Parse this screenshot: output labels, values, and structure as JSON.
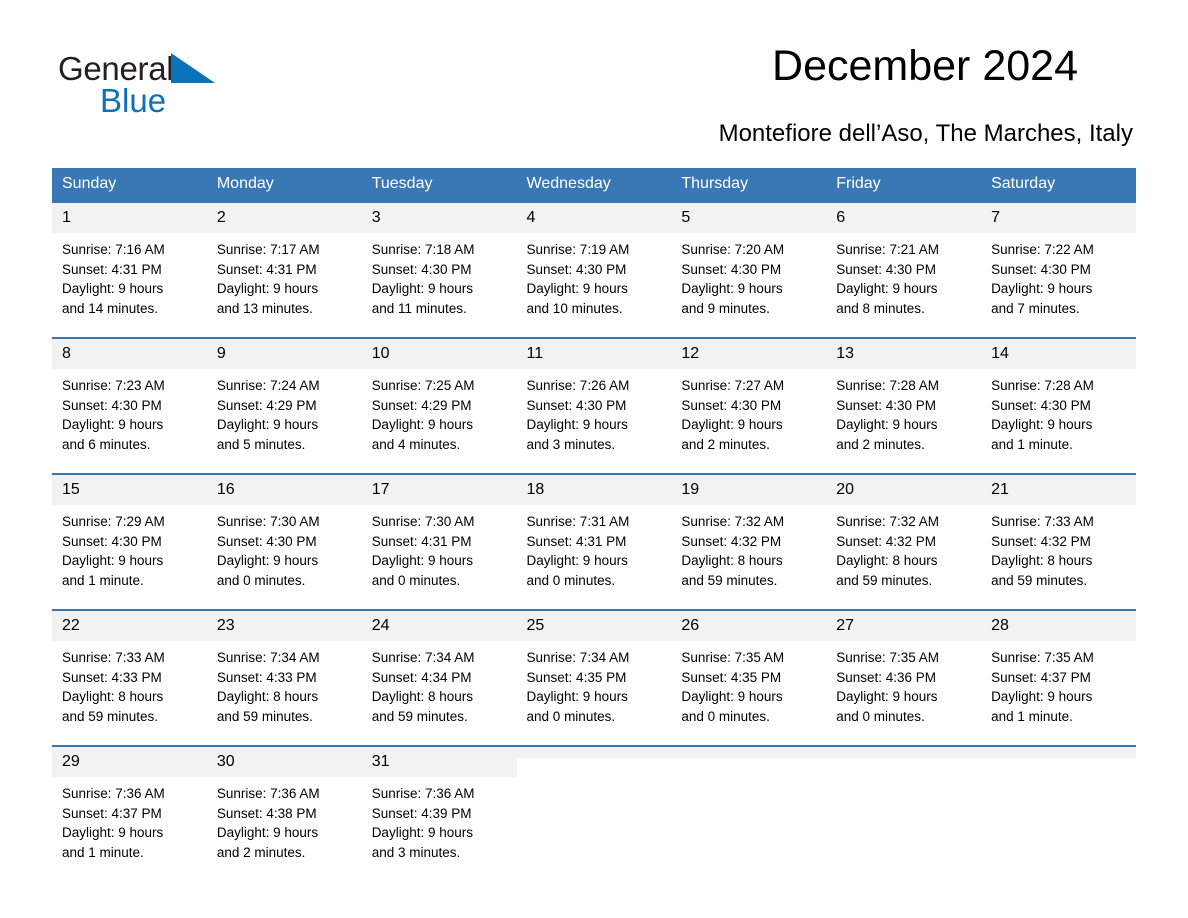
{
  "brand": {
    "name_part1": "General",
    "name_part2": "Blue",
    "accent_color": "#0b72b9",
    "triangle_icon": "triangle-icon"
  },
  "header": {
    "month_title": "December 2024",
    "location": "Montefiore dell’Aso, The Marches, Italy"
  },
  "calendar": {
    "header_bg": "#3a78b5",
    "daynum_bg": "#f2f2f2",
    "weekday_headers": [
      "Sunday",
      "Monday",
      "Tuesday",
      "Wednesday",
      "Thursday",
      "Friday",
      "Saturday"
    ],
    "weeks": [
      [
        {
          "day": "1",
          "sunrise": "Sunrise: 7:16 AM",
          "sunset": "Sunset: 4:31 PM",
          "daylight_line1": "Daylight: 9 hours",
          "daylight_line2": "and 14 minutes."
        },
        {
          "day": "2",
          "sunrise": "Sunrise: 7:17 AM",
          "sunset": "Sunset: 4:31 PM",
          "daylight_line1": "Daylight: 9 hours",
          "daylight_line2": "and 13 minutes."
        },
        {
          "day": "3",
          "sunrise": "Sunrise: 7:18 AM",
          "sunset": "Sunset: 4:30 PM",
          "daylight_line1": "Daylight: 9 hours",
          "daylight_line2": "and 11 minutes."
        },
        {
          "day": "4",
          "sunrise": "Sunrise: 7:19 AM",
          "sunset": "Sunset: 4:30 PM",
          "daylight_line1": "Daylight: 9 hours",
          "daylight_line2": "and 10 minutes."
        },
        {
          "day": "5",
          "sunrise": "Sunrise: 7:20 AM",
          "sunset": "Sunset: 4:30 PM",
          "daylight_line1": "Daylight: 9 hours",
          "daylight_line2": "and 9 minutes."
        },
        {
          "day": "6",
          "sunrise": "Sunrise: 7:21 AM",
          "sunset": "Sunset: 4:30 PM",
          "daylight_line1": "Daylight: 9 hours",
          "daylight_line2": "and 8 minutes."
        },
        {
          "day": "7",
          "sunrise": "Sunrise: 7:22 AM",
          "sunset": "Sunset: 4:30 PM",
          "daylight_line1": "Daylight: 9 hours",
          "daylight_line2": "and 7 minutes."
        }
      ],
      [
        {
          "day": "8",
          "sunrise": "Sunrise: 7:23 AM",
          "sunset": "Sunset: 4:30 PM",
          "daylight_line1": "Daylight: 9 hours",
          "daylight_line2": "and 6 minutes."
        },
        {
          "day": "9",
          "sunrise": "Sunrise: 7:24 AM",
          "sunset": "Sunset: 4:29 PM",
          "daylight_line1": "Daylight: 9 hours",
          "daylight_line2": "and 5 minutes."
        },
        {
          "day": "10",
          "sunrise": "Sunrise: 7:25 AM",
          "sunset": "Sunset: 4:29 PM",
          "daylight_line1": "Daylight: 9 hours",
          "daylight_line2": "and 4 minutes."
        },
        {
          "day": "11",
          "sunrise": "Sunrise: 7:26 AM",
          "sunset": "Sunset: 4:30 PM",
          "daylight_line1": "Daylight: 9 hours",
          "daylight_line2": "and 3 minutes."
        },
        {
          "day": "12",
          "sunrise": "Sunrise: 7:27 AM",
          "sunset": "Sunset: 4:30 PM",
          "daylight_line1": "Daylight: 9 hours",
          "daylight_line2": "and 2 minutes."
        },
        {
          "day": "13",
          "sunrise": "Sunrise: 7:28 AM",
          "sunset": "Sunset: 4:30 PM",
          "daylight_line1": "Daylight: 9 hours",
          "daylight_line2": "and 2 minutes."
        },
        {
          "day": "14",
          "sunrise": "Sunrise: 7:28 AM",
          "sunset": "Sunset: 4:30 PM",
          "daylight_line1": "Daylight: 9 hours",
          "daylight_line2": "and 1 minute."
        }
      ],
      [
        {
          "day": "15",
          "sunrise": "Sunrise: 7:29 AM",
          "sunset": "Sunset: 4:30 PM",
          "daylight_line1": "Daylight: 9 hours",
          "daylight_line2": "and 1 minute."
        },
        {
          "day": "16",
          "sunrise": "Sunrise: 7:30 AM",
          "sunset": "Sunset: 4:30 PM",
          "daylight_line1": "Daylight: 9 hours",
          "daylight_line2": "and 0 minutes."
        },
        {
          "day": "17",
          "sunrise": "Sunrise: 7:30 AM",
          "sunset": "Sunset: 4:31 PM",
          "daylight_line1": "Daylight: 9 hours",
          "daylight_line2": "and 0 minutes."
        },
        {
          "day": "18",
          "sunrise": "Sunrise: 7:31 AM",
          "sunset": "Sunset: 4:31 PM",
          "daylight_line1": "Daylight: 9 hours",
          "daylight_line2": "and 0 minutes."
        },
        {
          "day": "19",
          "sunrise": "Sunrise: 7:32 AM",
          "sunset": "Sunset: 4:32 PM",
          "daylight_line1": "Daylight: 8 hours",
          "daylight_line2": "and 59 minutes."
        },
        {
          "day": "20",
          "sunrise": "Sunrise: 7:32 AM",
          "sunset": "Sunset: 4:32 PM",
          "daylight_line1": "Daylight: 8 hours",
          "daylight_line2": "and 59 minutes."
        },
        {
          "day": "21",
          "sunrise": "Sunrise: 7:33 AM",
          "sunset": "Sunset: 4:32 PM",
          "daylight_line1": "Daylight: 8 hours",
          "daylight_line2": "and 59 minutes."
        }
      ],
      [
        {
          "day": "22",
          "sunrise": "Sunrise: 7:33 AM",
          "sunset": "Sunset: 4:33 PM",
          "daylight_line1": "Daylight: 8 hours",
          "daylight_line2": "and 59 minutes."
        },
        {
          "day": "23",
          "sunrise": "Sunrise: 7:34 AM",
          "sunset": "Sunset: 4:33 PM",
          "daylight_line1": "Daylight: 8 hours",
          "daylight_line2": "and 59 minutes."
        },
        {
          "day": "24",
          "sunrise": "Sunrise: 7:34 AM",
          "sunset": "Sunset: 4:34 PM",
          "daylight_line1": "Daylight: 8 hours",
          "daylight_line2": "and 59 minutes."
        },
        {
          "day": "25",
          "sunrise": "Sunrise: 7:34 AM",
          "sunset": "Sunset: 4:35 PM",
          "daylight_line1": "Daylight: 9 hours",
          "daylight_line2": "and 0 minutes."
        },
        {
          "day": "26",
          "sunrise": "Sunrise: 7:35 AM",
          "sunset": "Sunset: 4:35 PM",
          "daylight_line1": "Daylight: 9 hours",
          "daylight_line2": "and 0 minutes."
        },
        {
          "day": "27",
          "sunrise": "Sunrise: 7:35 AM",
          "sunset": "Sunset: 4:36 PM",
          "daylight_line1": "Daylight: 9 hours",
          "daylight_line2": "and 0 minutes."
        },
        {
          "day": "28",
          "sunrise": "Sunrise: 7:35 AM",
          "sunset": "Sunset: 4:37 PM",
          "daylight_line1": "Daylight: 9 hours",
          "daylight_line2": "and 1 minute."
        }
      ],
      [
        {
          "day": "29",
          "sunrise": "Sunrise: 7:36 AM",
          "sunset": "Sunset: 4:37 PM",
          "daylight_line1": "Daylight: 9 hours",
          "daylight_line2": "and 1 minute."
        },
        {
          "day": "30",
          "sunrise": "Sunrise: 7:36 AM",
          "sunset": "Sunset: 4:38 PM",
          "daylight_line1": "Daylight: 9 hours",
          "daylight_line2": "and 2 minutes."
        },
        {
          "day": "31",
          "sunrise": "Sunrise: 7:36 AM",
          "sunset": "Sunset: 4:39 PM",
          "daylight_line1": "Daylight: 9 hours",
          "daylight_line2": "and 3 minutes."
        },
        {
          "day": "",
          "sunrise": "",
          "sunset": "",
          "daylight_line1": "",
          "daylight_line2": ""
        },
        {
          "day": "",
          "sunrise": "",
          "sunset": "",
          "daylight_line1": "",
          "daylight_line2": ""
        },
        {
          "day": "",
          "sunrise": "",
          "sunset": "",
          "daylight_line1": "",
          "daylight_line2": ""
        },
        {
          "day": "",
          "sunrise": "",
          "sunset": "",
          "daylight_line1": "",
          "daylight_line2": ""
        }
      ]
    ]
  }
}
